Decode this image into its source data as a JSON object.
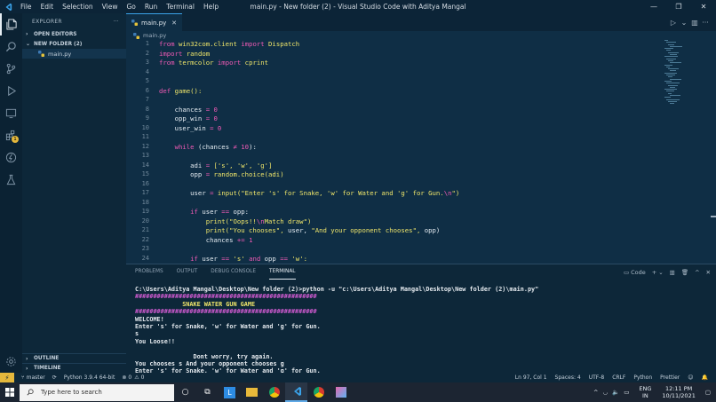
{
  "window": {
    "title": "main.py - New folder (2) - Visual Studio Code with Aditya Mangal",
    "menu": [
      "File",
      "Edit",
      "Selection",
      "View",
      "Go",
      "Run",
      "Terminal",
      "Help"
    ],
    "controls": [
      "—",
      "❐",
      "✕"
    ]
  },
  "sidebar": {
    "header": "EXPLORER",
    "more": "···",
    "open_editors": "OPEN EDITORS",
    "folder": "NEW FOLDER (2)",
    "file": "main.py",
    "outline": "OUTLINE",
    "timeline": "TIMELINE",
    "extensions_badge": "1"
  },
  "editor": {
    "tab_label": "main.py",
    "breadcrumb": "main.py",
    "line_numbers": [
      "1",
      "2",
      "3",
      "4",
      "5",
      "6",
      "7",
      "8",
      "9",
      "10",
      "11",
      "12",
      "13",
      "14",
      "15",
      "16",
      "17",
      "18",
      "19",
      "20",
      "21",
      "22",
      "23",
      "24"
    ],
    "lines": [
      [
        {
          "t": "from ",
          "c": "#f05ab5"
        },
        {
          "t": "win32com.client ",
          "c": "#f0e66a"
        },
        {
          "t": "import ",
          "c": "#f05ab5"
        },
        {
          "t": "Dispatch",
          "c": "#f0e66a"
        }
      ],
      [
        {
          "t": "import ",
          "c": "#f05ab5"
        },
        {
          "t": "random",
          "c": "#f0e66a"
        }
      ],
      [
        {
          "t": "from ",
          "c": "#f05ab5"
        },
        {
          "t": "termcolor ",
          "c": "#f0e66a"
        },
        {
          "t": "import ",
          "c": "#f05ab5"
        },
        {
          "t": "cprint",
          "c": "#f0e66a"
        }
      ],
      [],
      [],
      [
        {
          "t": "def ",
          "c": "#f05ab5"
        },
        {
          "t": "game",
          "c": "#f0e66a"
        },
        {
          "t": "():",
          "c": "#f0e66a"
        }
      ],
      [],
      [
        {
          "t": "    chances ",
          "c": "#e6edf3"
        },
        {
          "t": "= ",
          "c": "#f05ab5"
        },
        {
          "t": "0",
          "c": "#f05ab5"
        }
      ],
      [
        {
          "t": "    opp_win ",
          "c": "#e6edf3"
        },
        {
          "t": "= ",
          "c": "#f05ab5"
        },
        {
          "t": "0",
          "c": "#f05ab5"
        }
      ],
      [
        {
          "t": "    user_win ",
          "c": "#e6edf3"
        },
        {
          "t": "= ",
          "c": "#f05ab5"
        },
        {
          "t": "0",
          "c": "#f05ab5"
        }
      ],
      [],
      [
        {
          "t": "    while ",
          "c": "#f05ab5"
        },
        {
          "t": "(chances ",
          "c": "#e6edf3"
        },
        {
          "t": "≠ ",
          "c": "#f05ab5"
        },
        {
          "t": "10",
          "c": "#f05ab5"
        },
        {
          "t": "):",
          "c": "#e6edf3"
        }
      ],
      [],
      [
        {
          "t": "        adi ",
          "c": "#e6edf3"
        },
        {
          "t": "= ",
          "c": "#f05ab5"
        },
        {
          "t": "['s', 'w', 'g']",
          "c": "#f0e66a"
        }
      ],
      [
        {
          "t": "        opp ",
          "c": "#e6edf3"
        },
        {
          "t": "= ",
          "c": "#f05ab5"
        },
        {
          "t": "random.choice(adi)",
          "c": "#f0e66a"
        }
      ],
      [],
      [
        {
          "t": "        user ",
          "c": "#e6edf3"
        },
        {
          "t": "= ",
          "c": "#f05ab5"
        },
        {
          "t": "input(",
          "c": "#f0e66a"
        },
        {
          "t": "\"Enter 's' for Snake, 'w' for Water and 'g' for Gun.",
          "c": "#f0e66a"
        },
        {
          "t": "\\n",
          "c": "#f05ab5"
        },
        {
          "t": "\")",
          "c": "#f0e66a"
        }
      ],
      [],
      [
        {
          "t": "        if ",
          "c": "#f05ab5"
        },
        {
          "t": "user ",
          "c": "#e6edf3"
        },
        {
          "t": "== ",
          "c": "#f05ab5"
        },
        {
          "t": "opp:",
          "c": "#e6edf3"
        }
      ],
      [
        {
          "t": "            print(",
          "c": "#f0e66a"
        },
        {
          "t": "\"Oops!!",
          "c": "#f0e66a"
        },
        {
          "t": "\\n",
          "c": "#f05ab5"
        },
        {
          "t": "Match draw\")",
          "c": "#f0e66a"
        }
      ],
      [
        {
          "t": "            print(",
          "c": "#f0e66a"
        },
        {
          "t": "\"You chooses\", ",
          "c": "#f0e66a"
        },
        {
          "t": "user, ",
          "c": "#e6edf3"
        },
        {
          "t": "\"And your opponent chooses\", ",
          "c": "#f0e66a"
        },
        {
          "t": "opp)",
          "c": "#e6edf3"
        }
      ],
      [
        {
          "t": "            chances ",
          "c": "#e6edf3"
        },
        {
          "t": "+= ",
          "c": "#f05ab5"
        },
        {
          "t": "1",
          "c": "#f05ab5"
        }
      ],
      [],
      [
        {
          "t": "        if ",
          "c": "#f05ab5"
        },
        {
          "t": "user ",
          "c": "#e6edf3"
        },
        {
          "t": "== ",
          "c": "#f05ab5"
        },
        {
          "t": "'s' ",
          "c": "#f0e66a"
        },
        {
          "t": "and ",
          "c": "#f05ab5"
        },
        {
          "t": "opp ",
          "c": "#e6edf3"
        },
        {
          "t": "== ",
          "c": "#f05ab5"
        },
        {
          "t": "'w':",
          "c": "#f0e66a"
        }
      ]
    ]
  },
  "panel": {
    "tabs": [
      "PROBLEMS",
      "OUTPUT",
      "DEBUG CONSOLE",
      "TERMINAL"
    ],
    "active_tab": "TERMINAL",
    "shell": "Code",
    "actions": [
      "+",
      "⌄",
      "▥",
      "🗑",
      "^",
      "✕"
    ],
    "terminal_lines": [
      {
        "t": "C:\\Users\\Aditya Mangal\\Desktop\\New folder (2)>python -u \"c:\\Users\\Aditya Mangal\\Desktop\\New folder (2)\\main.py\"",
        "k": "plain"
      },
      {
        "t": "##################################################",
        "k": "mag"
      },
      {
        "t": "             SNAKE WATER GUN GAME",
        "k": "yel"
      },
      {
        "t": "##################################################",
        "k": "mag"
      },
      {
        "t": "WELCOME!",
        "k": "plain"
      },
      {
        "t": "Enter 's' for Snake, 'w' for Water and 'g' for Gun.",
        "k": "plain"
      },
      {
        "t": "s",
        "k": "plain"
      },
      {
        "t": "You Loose!!",
        "k": "plain"
      },
      {
        "t": "",
        "k": "plain"
      },
      {
        "t": "                Dont worry, try again.",
        "k": "plain"
      },
      {
        "t": "You chooses s And your opponent chooses g",
        "k": "plain"
      },
      {
        "t": "Enter 's' for Snake, 'w' for Water and 'g' for Gun.",
        "k": "plain"
      }
    ]
  },
  "status": {
    "branch": "master",
    "interpreter": "Python 3.9.4 64-bit",
    "errors": "0",
    "warnings": "0",
    "position": "Ln 97, Col 1",
    "spaces": "Spaces: 4",
    "encoding": "UTF-8",
    "eol": "CRLF",
    "language": "Python",
    "formatter": "Prettier"
  },
  "taskbar": {
    "search_placeholder": "Type here to search",
    "lang_top": "ENG",
    "lang_bottom": "IN",
    "time": "12:11 PM",
    "date": "10/11/2021"
  },
  "colors": {
    "accent": "#3aa2e8",
    "keyword": "#f05ab5",
    "string": "#f0e66a",
    "terminal_magenta": "#d35bd3",
    "terminal_yellow": "#f0e66a"
  }
}
